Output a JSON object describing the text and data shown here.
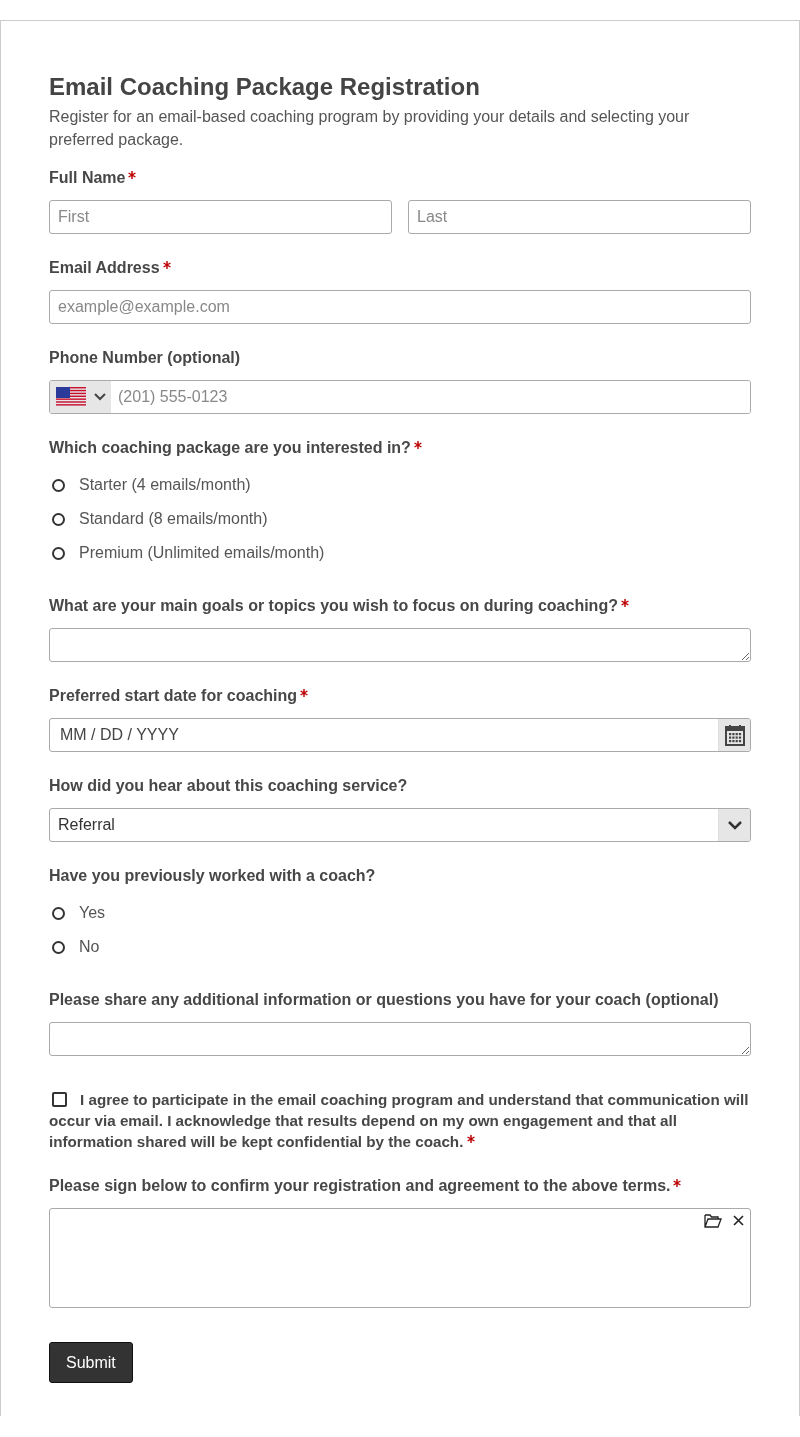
{
  "title": "Email Coaching Package Registration",
  "description": "Register for an email-based coaching program by providing your details and selecting your preferred package.",
  "fields": [
    {
      "kind": "name",
      "label": "Full Name",
      "required": true,
      "first_placeholder": "First",
      "last_placeholder": "Last"
    },
    {
      "kind": "email",
      "label": "Email Address",
      "required": true,
      "placeholder": "example@example.com"
    },
    {
      "kind": "phone",
      "label": "Phone Number (optional)",
      "required": false,
      "placeholder": "(201) 555-0123"
    },
    {
      "kind": "radio",
      "label": "Which coaching package are you interested in?",
      "required": true,
      "options": [
        {
          "label": "Starter (4 emails/month)",
          "selected": false
        },
        {
          "label": "Standard (8 emails/month)",
          "selected": false
        },
        {
          "label": "Premium (Unlimited emails/month)",
          "selected": false
        }
      ]
    },
    {
      "kind": "textarea",
      "label": "What are your main goals or topics you wish to focus on during coaching?",
      "required": true
    },
    {
      "kind": "date",
      "label": "Preferred start date for coaching",
      "required": true,
      "placeholder": "MM / DD / YYYY"
    },
    {
      "kind": "select",
      "label": "How did you hear about this coaching service?",
      "required": false,
      "value": "Referral"
    },
    {
      "kind": "radio",
      "label": "Have you previously worked with a coach?",
      "required": false,
      "options": [
        {
          "label": "Yes",
          "selected": false
        },
        {
          "label": "No",
          "selected": false
        }
      ]
    },
    {
      "kind": "textarea",
      "label": "Please share any additional information or questions you have for your coach (optional)",
      "required": false
    },
    {
      "kind": "checkbox",
      "label": "I agree to participate in the email coaching program and understand that communication will occur via email. I acknowledge that results depend on my own engagement and that all information shared will be kept confidential by the coach.",
      "required": true,
      "checked": false
    },
    {
      "kind": "signature",
      "label": "Please sign below to confirm your registration and agreement to the above terms.",
      "required": true
    }
  ],
  "submit": "Submit"
}
